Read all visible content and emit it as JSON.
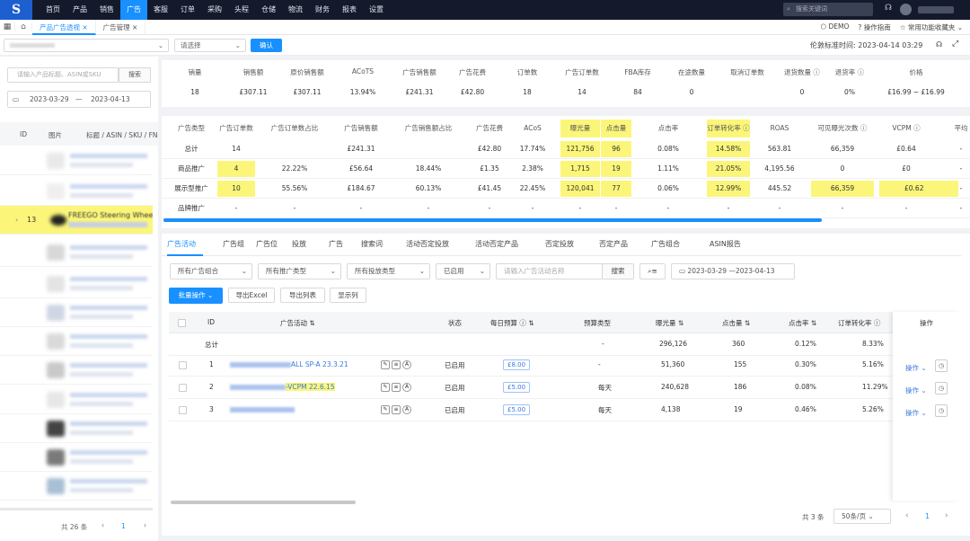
{
  "topnav": {
    "logo": "S",
    "items": [
      "首页",
      "产品",
      "销售",
      "广告",
      "客服",
      "订单",
      "采购",
      "头程",
      "仓储",
      "物流",
      "财务",
      "报表",
      "设置"
    ],
    "active_index": 3,
    "search_placeholder": "搜索关键词"
  },
  "tabs": {
    "items": [
      "产品广告透视",
      "广告管理"
    ],
    "active_index": 0
  },
  "tabright": {
    "demo": "DEMO",
    "guide": "操作指南",
    "favorites": "常用功能收藏夹"
  },
  "filterbar": {
    "select_placeholder": "请选择",
    "confirm": "确认",
    "time_label": "伦敦标准时间: 2023-04-14 03:29"
  },
  "left": {
    "search_placeholder": "请输入产品标题、ASIN或SKU",
    "search_btn": "搜索",
    "date_start": "2023-03-29",
    "date_sep": "—",
    "date_end": "2023-04-13",
    "col_id": "ID",
    "col_img": "图片",
    "col_title": "标题 / ASIN / SKU / FN",
    "selected_id": "13",
    "selected_title": "FREEGO Steering Wheel",
    "pager_total": "共 26 条",
    "pager_page": "1"
  },
  "summary": {
    "headers": [
      "销量",
      "销售额",
      "原价销售额",
      "ACoTS",
      "广告销售额",
      "广告花费",
      "订单数",
      "广告订单数",
      "FBA库存",
      "在途数量",
      "取消订单数",
      "退货数量",
      "退货率",
      "价格"
    ],
    "values": [
      "18",
      "£307.11",
      "£307.11",
      "13.94%",
      "£241.31",
      "£42.80",
      "18",
      "14",
      "84",
      "0",
      "",
      "0",
      "0%",
      "£16.99 ~ £16.99"
    ]
  },
  "adtype": {
    "headers": [
      "广告类型",
      "广告订单数",
      "广告订单数占比",
      "广告销售额",
      "广告销售额占比",
      "广告花费",
      "ACoS",
      "曝光量",
      "点击量",
      "点击率",
      "订单转化率",
      "ROAS",
      "可见曝光次数",
      "VCPM",
      "平均"
    ],
    "rows": [
      [
        "总计",
        "14",
        "",
        "£241.31",
        "",
        "£42.80",
        "17.74%",
        "121,756",
        "96",
        "0.08%",
        "14.58%",
        "563.81",
        "66,359",
        "£0.64",
        "-"
      ],
      [
        "商品推广",
        "4",
        "22.22%",
        "£56.64",
        "18.44%",
        "£1.35",
        "2.38%",
        "1,715",
        "19",
        "1.11%",
        "21.05%",
        "4,195.56",
        "0",
        "£0",
        "-"
      ],
      [
        "展示型推广",
        "10",
        "55.56%",
        "£184.67",
        "60.13%",
        "£41.45",
        "22.45%",
        "120,041",
        "77",
        "0.06%",
        "12.99%",
        "445.52",
        "66,359",
        "£0.62",
        "-"
      ],
      [
        "品牌推广",
        "-",
        "-",
        "-",
        "-",
        "-",
        "-",
        "-",
        "-",
        "-",
        "-",
        "-",
        "-",
        "-",
        "-"
      ]
    ]
  },
  "subtabs": [
    "广告活动",
    "广告组",
    "广告位",
    "投放",
    "广告",
    "搜索词",
    "活动否定投放",
    "活动否定产品",
    "否定投放",
    "否定产品",
    "广告组合",
    "ASIN报告"
  ],
  "controls": {
    "portfolio": "所有广告组合",
    "promo_type": "所有推广类型",
    "target_type": "所有投放类型",
    "state": "已启用",
    "campaign_placeholder": "请输入广告活动名称",
    "search": "搜索",
    "date_range": "2023-03-29 —2023-04-13",
    "batch": "批量操作",
    "export_excel": "导出Excel",
    "export_list": "导出列表",
    "show_cols": "显示列"
  },
  "table": {
    "headers": [
      "ID",
      "广告活动",
      "状态",
      "每日预算",
      "预算类型",
      "曝光量",
      "点击量",
      "点击率",
      "订单转化率",
      "操作"
    ],
    "total": {
      "label": "总计",
      "budget_type": "-",
      "impr": "296,126",
      "clicks": "360",
      "ctr": "0.12%",
      "cvr": "8.33%"
    },
    "rows": [
      {
        "id": "1",
        "name_suffix": "ALL SP-A 23.3.21",
        "status": "已启用",
        "budget": "£8.00",
        "budget_type": "-",
        "impr": "51,360",
        "clicks": "155",
        "ctr": "0.30%",
        "cvr": "5.16%",
        "op": "操作"
      },
      {
        "id": "2",
        "name_suffix": "-VCPM 22.6.15",
        "status": "已启用",
        "budget": "£5.00",
        "budget_type": "每天",
        "impr": "240,628",
        "clicks": "186",
        "ctr": "0.08%",
        "cvr": "11.29%",
        "op": "操作"
      },
      {
        "id": "3",
        "name_suffix": "",
        "status": "已启用",
        "budget": "£5.00",
        "budget_type": "每天",
        "impr": "4,138",
        "clicks": "19",
        "ctr": "0.46%",
        "cvr": "5.26%",
        "op": "操作"
      }
    ],
    "pager_total": "共 3 条",
    "page_size": "50条/页",
    "page": "1"
  },
  "colors": {
    "nav_bg": "#141a2b",
    "accent": "#1890ff",
    "highlight": "#fbf67a"
  }
}
